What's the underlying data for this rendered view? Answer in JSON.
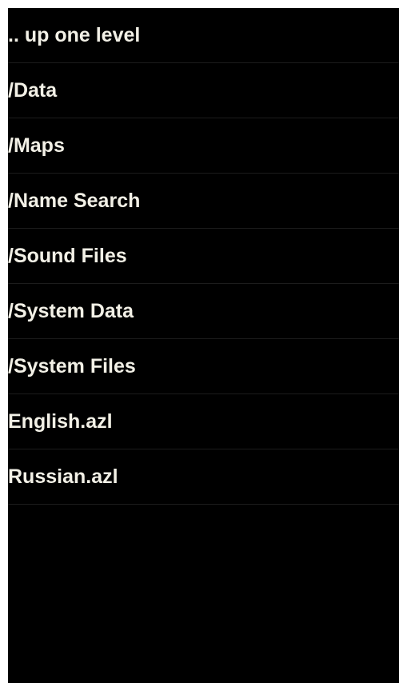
{
  "file_browser": {
    "items": [
      {
        "label": ".. up one level"
      },
      {
        "label": "/Data"
      },
      {
        "label": "/Maps"
      },
      {
        "label": "/Name Search"
      },
      {
        "label": "/Sound Files"
      },
      {
        "label": "/System Data"
      },
      {
        "label": "/System Files"
      },
      {
        "label": "English.azl"
      },
      {
        "label": "Russian.azl"
      }
    ]
  },
  "colors": {
    "background": "#000000",
    "text": "#f2f0e6",
    "divider": "#1c1c1c"
  }
}
